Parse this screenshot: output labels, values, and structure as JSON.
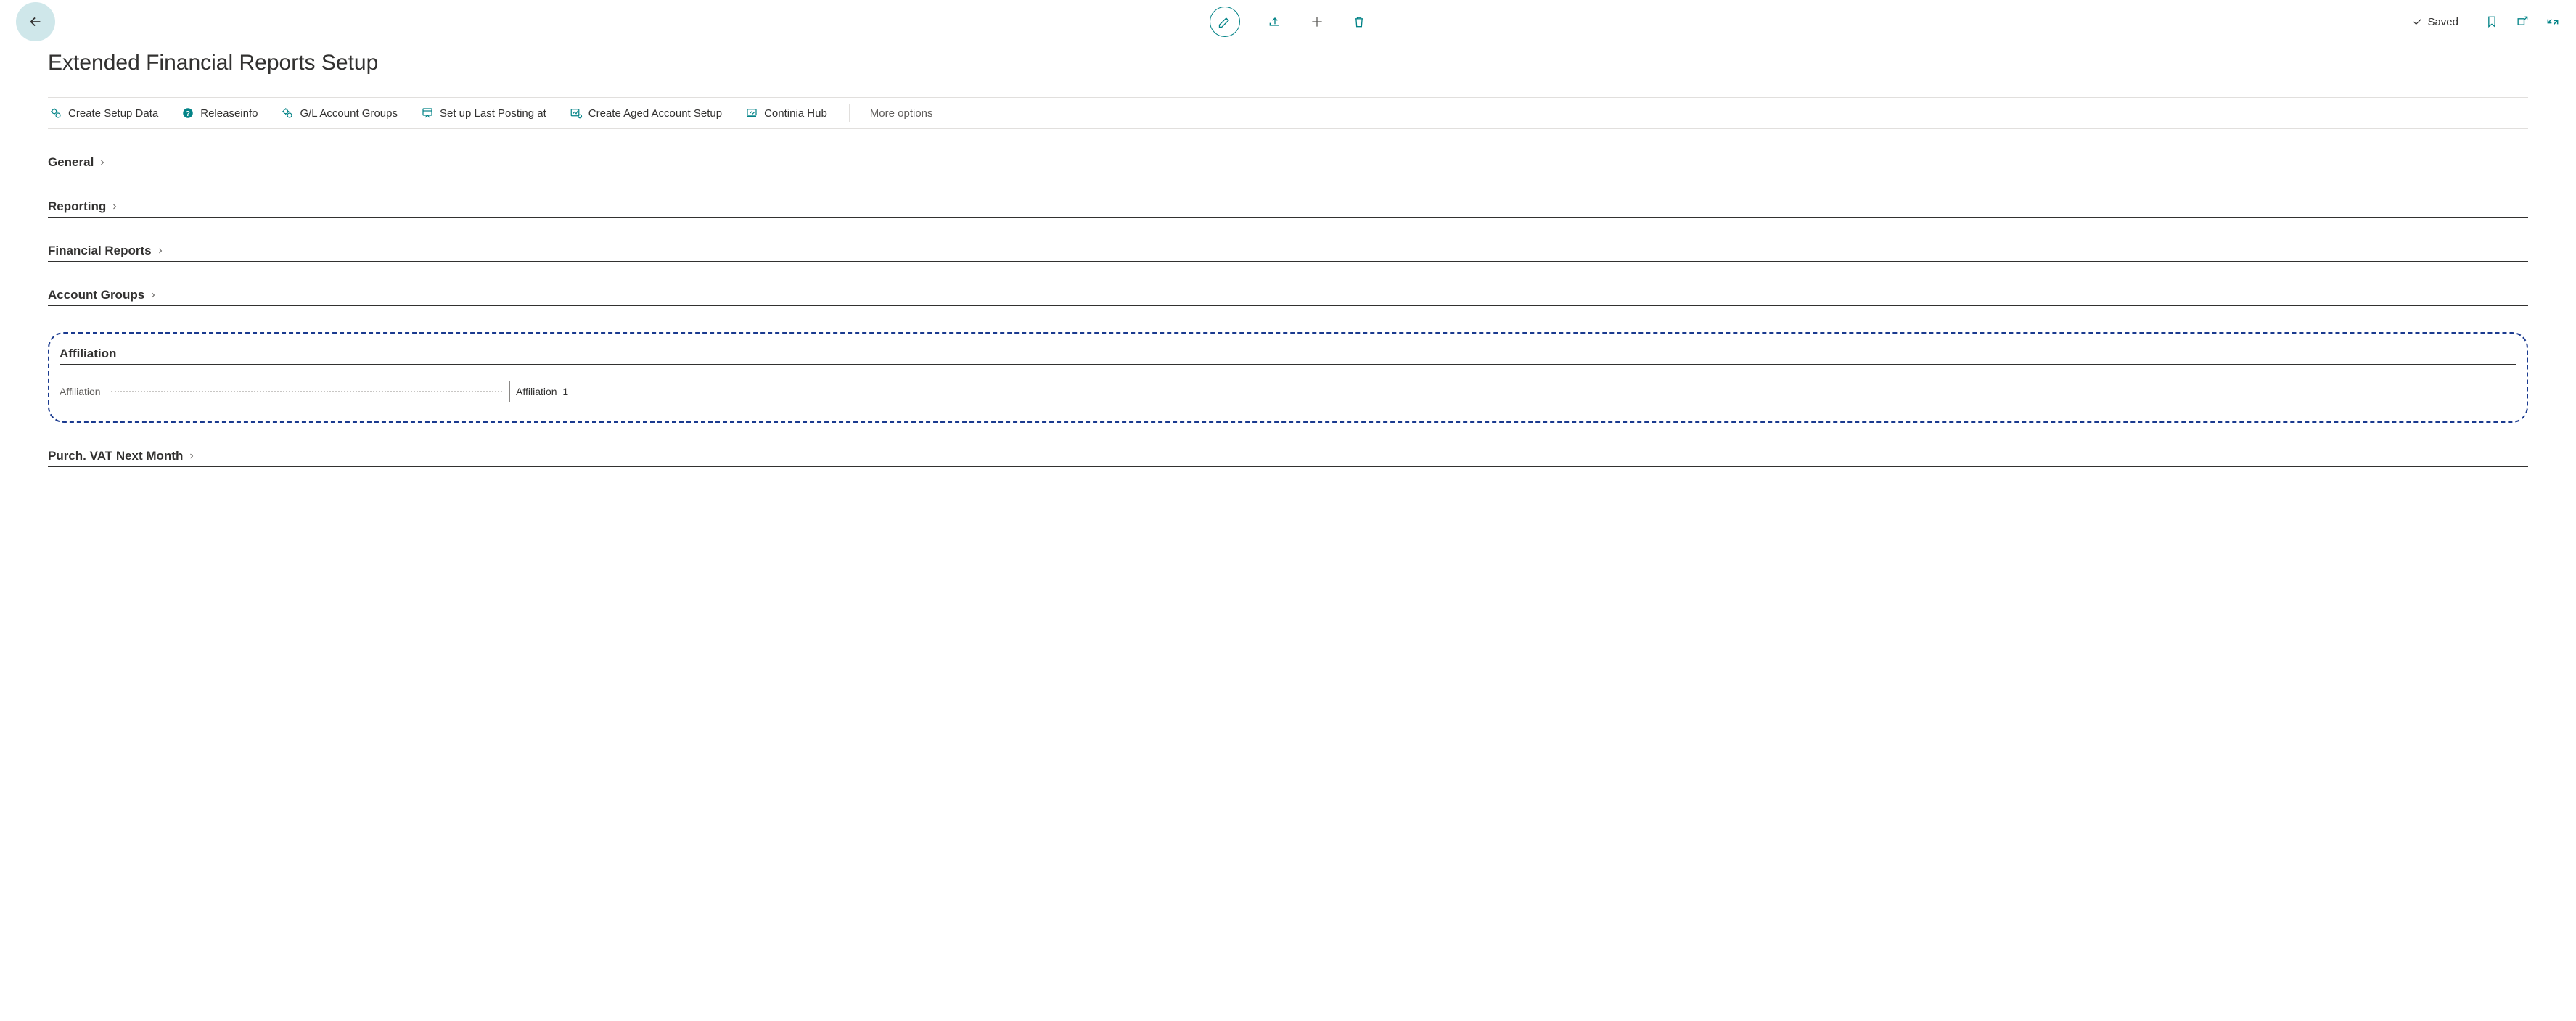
{
  "page": {
    "title": "Extended Financial Reports Setup",
    "saved_label": "Saved"
  },
  "actions": {
    "create_setup_data": "Create Setup Data",
    "releaseinfo": "Releaseinfo",
    "gl_account_groups": "G/L Account Groups",
    "set_up_last_posting": "Set up Last Posting at",
    "create_aged_account": "Create Aged Account Setup",
    "continia_hub": "Continia Hub",
    "more_options": "More options"
  },
  "sections": {
    "general": "General",
    "reporting": "Reporting",
    "financial_reports": "Financial Reports",
    "account_groups": "Account Groups",
    "affiliation": "Affiliation",
    "purch_vat": "Purch. VAT Next Month"
  },
  "fields": {
    "affiliation": {
      "label": "Affiliation",
      "value": "Affiliation_1"
    }
  }
}
